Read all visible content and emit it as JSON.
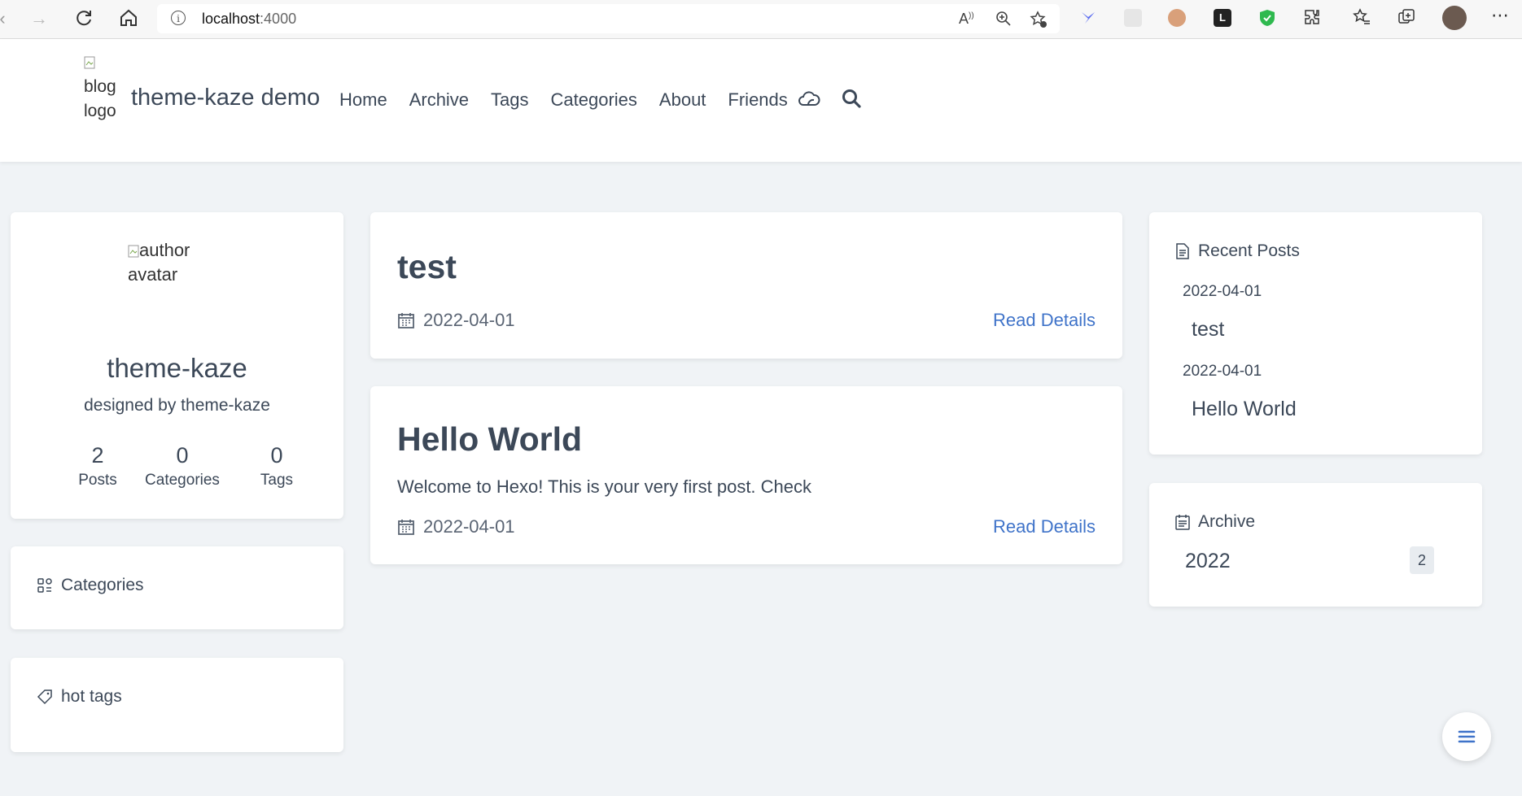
{
  "browser": {
    "url_host": "localhost",
    "url_port": ":4000"
  },
  "header": {
    "logo_alt": "blog logo",
    "brand": "theme-kaze demo",
    "menu": [
      "Home",
      "Archive",
      "Tags",
      "Categories",
      "About",
      "Friends"
    ]
  },
  "profile": {
    "avatar_alt": "author avatar",
    "name": "theme-kaze",
    "description": "designed by theme-kaze",
    "stats": [
      {
        "value": "2",
        "label": "Posts"
      },
      {
        "value": "0",
        "label": "Categories"
      },
      {
        "value": "0",
        "label": "Tags"
      }
    ]
  },
  "widgets": {
    "categories_title": "Categories",
    "tags_title": "hot tags"
  },
  "posts": [
    {
      "title": "test",
      "date": "2022-04-01",
      "excerpt": "",
      "read_label": "Read Details"
    },
    {
      "title": "Hello World",
      "date": "2022-04-01",
      "excerpt": "Welcome to Hexo! This is your very first post. Check",
      "read_label": "Read Details"
    }
  ],
  "recent": {
    "title": "Recent Posts",
    "items": [
      {
        "date": "2022-04-01",
        "title": "test"
      },
      {
        "date": "2022-04-01",
        "title": "Hello World"
      }
    ]
  },
  "archive": {
    "title": "Archive",
    "year": "2022",
    "count": "2"
  },
  "colors": {
    "background": "#f0f3f6",
    "text": "#3c4858",
    "link": "#3f73c9"
  }
}
